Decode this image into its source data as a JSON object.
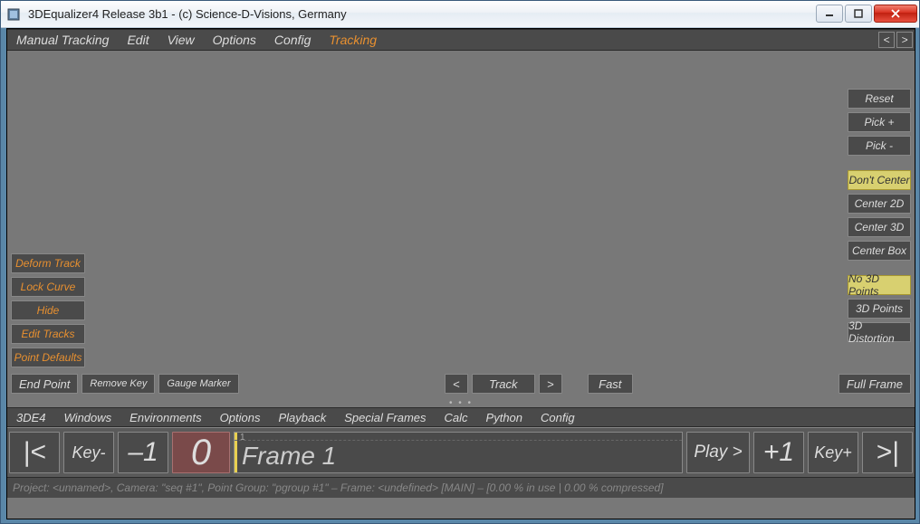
{
  "window": {
    "title": "3DEqualizer4 Release 3b1   -   (c) Science-D-Visions, Germany"
  },
  "menu_top": {
    "items": [
      "Manual Tracking",
      "Edit",
      "View",
      "Options",
      "Config",
      "Tracking"
    ],
    "active_index": 5,
    "nav_prev": "<",
    "nav_next": ">"
  },
  "left_buttons": [
    "Deform Track",
    "Lock Curve",
    "Hide",
    "Edit Tracks",
    "Point Defaults"
  ],
  "right_groups": [
    {
      "items": [
        {
          "label": "Reset",
          "active": false
        },
        {
          "label": "Pick +",
          "active": false
        },
        {
          "label": "Pick -",
          "active": false
        }
      ]
    },
    {
      "items": [
        {
          "label": "Don't Center",
          "active": true
        },
        {
          "label": "Center 2D",
          "active": false
        },
        {
          "label": "Center 3D",
          "active": false
        },
        {
          "label": "Center Box",
          "active": false
        }
      ]
    },
    {
      "items": [
        {
          "label": "No 3D Points",
          "active": true
        },
        {
          "label": "3D Points",
          "active": false
        },
        {
          "label": "3D Distortion",
          "active": false
        }
      ]
    }
  ],
  "viewport_bottom": {
    "end_point": "End Point",
    "remove_key": "Remove Key",
    "gauge_marker": "Gauge Marker",
    "prev": "<",
    "track": "Track",
    "next": ">",
    "fast": "Fast",
    "full_frame": "Full Frame"
  },
  "menu_bottom": {
    "items": [
      "3DE4",
      "Windows",
      "Environments",
      "Options",
      "Playback",
      "Special Frames",
      "Calc",
      "Python",
      "Config"
    ]
  },
  "playbar": {
    "start": "|<",
    "key_minus": "Key-",
    "minus1": "–1",
    "current": "0",
    "frame_num": "1",
    "frame_label": "Frame 1",
    "play": "Play >",
    "plus1": "+1",
    "key_plus": "Key+",
    "end": ">|"
  },
  "status": "Project: <unnamed>, Camera: \"seq #1\", Point Group: \"pgroup #1\"  –  Frame: <undefined>  [MAIN]  –  [0.00 % in use | 0.00 % compressed]"
}
